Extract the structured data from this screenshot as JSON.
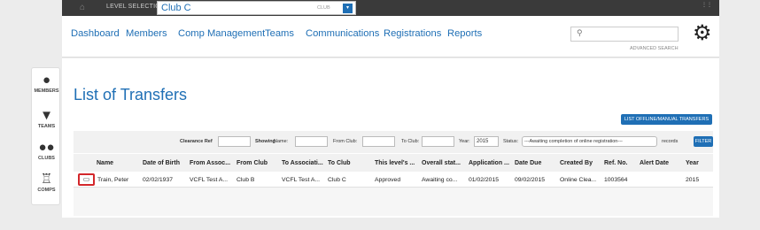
{
  "topbar": {
    "level_label": "LEVEL SELECTION",
    "club_name": "Club C",
    "club_tag": "CLUB",
    "dropdown_glyph": "▾",
    "corner_text": "⋮⋮\n⋮⋮"
  },
  "nav": {
    "items": [
      "Dashboard",
      "Members",
      "Comp Management",
      "Teams",
      "Communications",
      "Registrations",
      "Reports"
    ],
    "search_placeholder": "",
    "advanced_search": "ADVANCED SEARCH"
  },
  "sidebar": {
    "items": [
      "MEMBERS",
      "TEAMS",
      "CLUBS",
      "COMPS"
    ]
  },
  "main": {
    "title": "List of Transfers",
    "offline_button": "LIST OFFLINE/MANUAL TRANSFERS",
    "filters": {
      "clearance_ref": "Clearance Ref",
      "showing": "Showing",
      "name": "Name:",
      "from_club": "From Club:",
      "to_club": "To Club:",
      "year": "Year:",
      "year_value": "2015",
      "status": "Status:",
      "status_value": "---Awaiting completion of online registration---",
      "records": "records",
      "filter_button": "FILTER"
    },
    "columns": [
      "Name",
      "Date of Birth",
      "From Assoc...",
      "From Club",
      "To Associati...",
      "To Club",
      "This level's ...",
      "Overall stat...",
      "Application ...",
      "Date Due",
      "Created By",
      "Ref. No.",
      "Alert Date",
      "Year"
    ],
    "rows": [
      [
        "Train, Peter",
        "02/02/1937",
        "VCFL Test A...",
        "Club B",
        "VCFL Test A...",
        "Club C",
        "Approved",
        "Awaiting co...",
        "01/02/2015",
        "09/02/2015",
        "Online Clea...",
        "1003564",
        "",
        "2015"
      ]
    ]
  },
  "colors": {
    "accent": "#1f6fb5",
    "highlight": "#d3272b",
    "topbar": "#3a3a3a"
  }
}
